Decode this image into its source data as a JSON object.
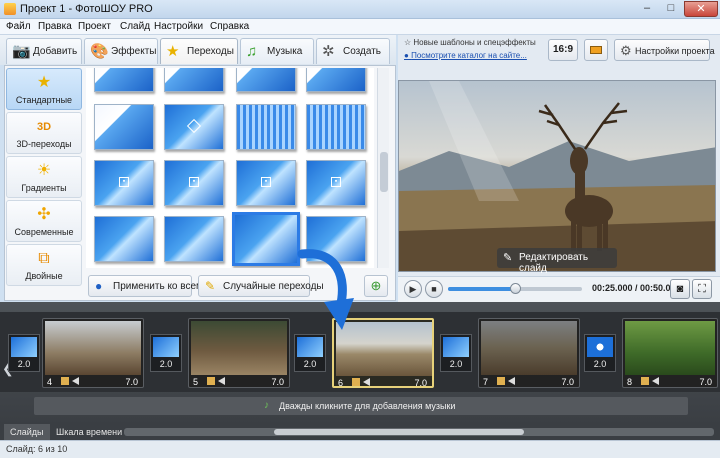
{
  "window": {
    "title": "Проект 1 - ФотоШОУ PRO",
    "min": "–",
    "max": "□",
    "close": "✕"
  },
  "menu": [
    "Файл",
    "Правка",
    "Проект",
    "Слайд",
    "Настройки",
    "Справка"
  ],
  "tabs": [
    {
      "label": "Добавить",
      "icon": "camera-icon"
    },
    {
      "label": "Эффекты",
      "icon": "palette-icon"
    },
    {
      "label": "Переходы",
      "icon": "star-icon",
      "active": true
    },
    {
      "label": "Музыка",
      "icon": "music-note-icon"
    },
    {
      "label": "Создать",
      "icon": "film-reel-icon"
    }
  ],
  "categories": [
    {
      "label": "Стандартные",
      "icon": "star-icon",
      "active": true
    },
    {
      "label": "3D-переходы",
      "icon": "3d-icon"
    },
    {
      "label": "Градиенты",
      "icon": "gradient-icon"
    },
    {
      "label": "Современные",
      "icon": "puzzle-icon"
    },
    {
      "label": "Двойные",
      "icon": "double-icon"
    }
  ],
  "panel_buttons": {
    "apply_all": "Применить ко всем",
    "random": "Случайные переходы"
  },
  "header_right": {
    "news": "Новые шаблоны и спецэффекты",
    "catalog_link": "Посмотрите каталог на сайте...",
    "ratio": "16:9",
    "settings": "Настройки проекта"
  },
  "preview": {
    "edit_button": "Редактировать слайд"
  },
  "player": {
    "time": "00:25.000 / 00:50.000",
    "progress": 0.5
  },
  "timeline": {
    "slides": [
      {
        "num": "4",
        "dur": "7.0"
      },
      {
        "num": "5",
        "dur": "7.0"
      },
      {
        "num": "6",
        "dur": "7.0",
        "current": true
      },
      {
        "num": "7",
        "dur": "7.0"
      },
      {
        "num": "8",
        "dur": "7.0"
      }
    ],
    "transitions": [
      "2.0",
      "2.0",
      "2.0",
      "2.0",
      "2.0"
    ],
    "music_hint": "Дважды кликните для добавления музыки"
  },
  "bottom_tabs": {
    "slides": "Слайды",
    "timeline": "Шкала времени"
  },
  "status": "Слайд: 6 из 10",
  "colors": {
    "accent": "#2c7be5",
    "current_slide_border": "#e7d27a",
    "music_icon": "#6fc35a"
  }
}
